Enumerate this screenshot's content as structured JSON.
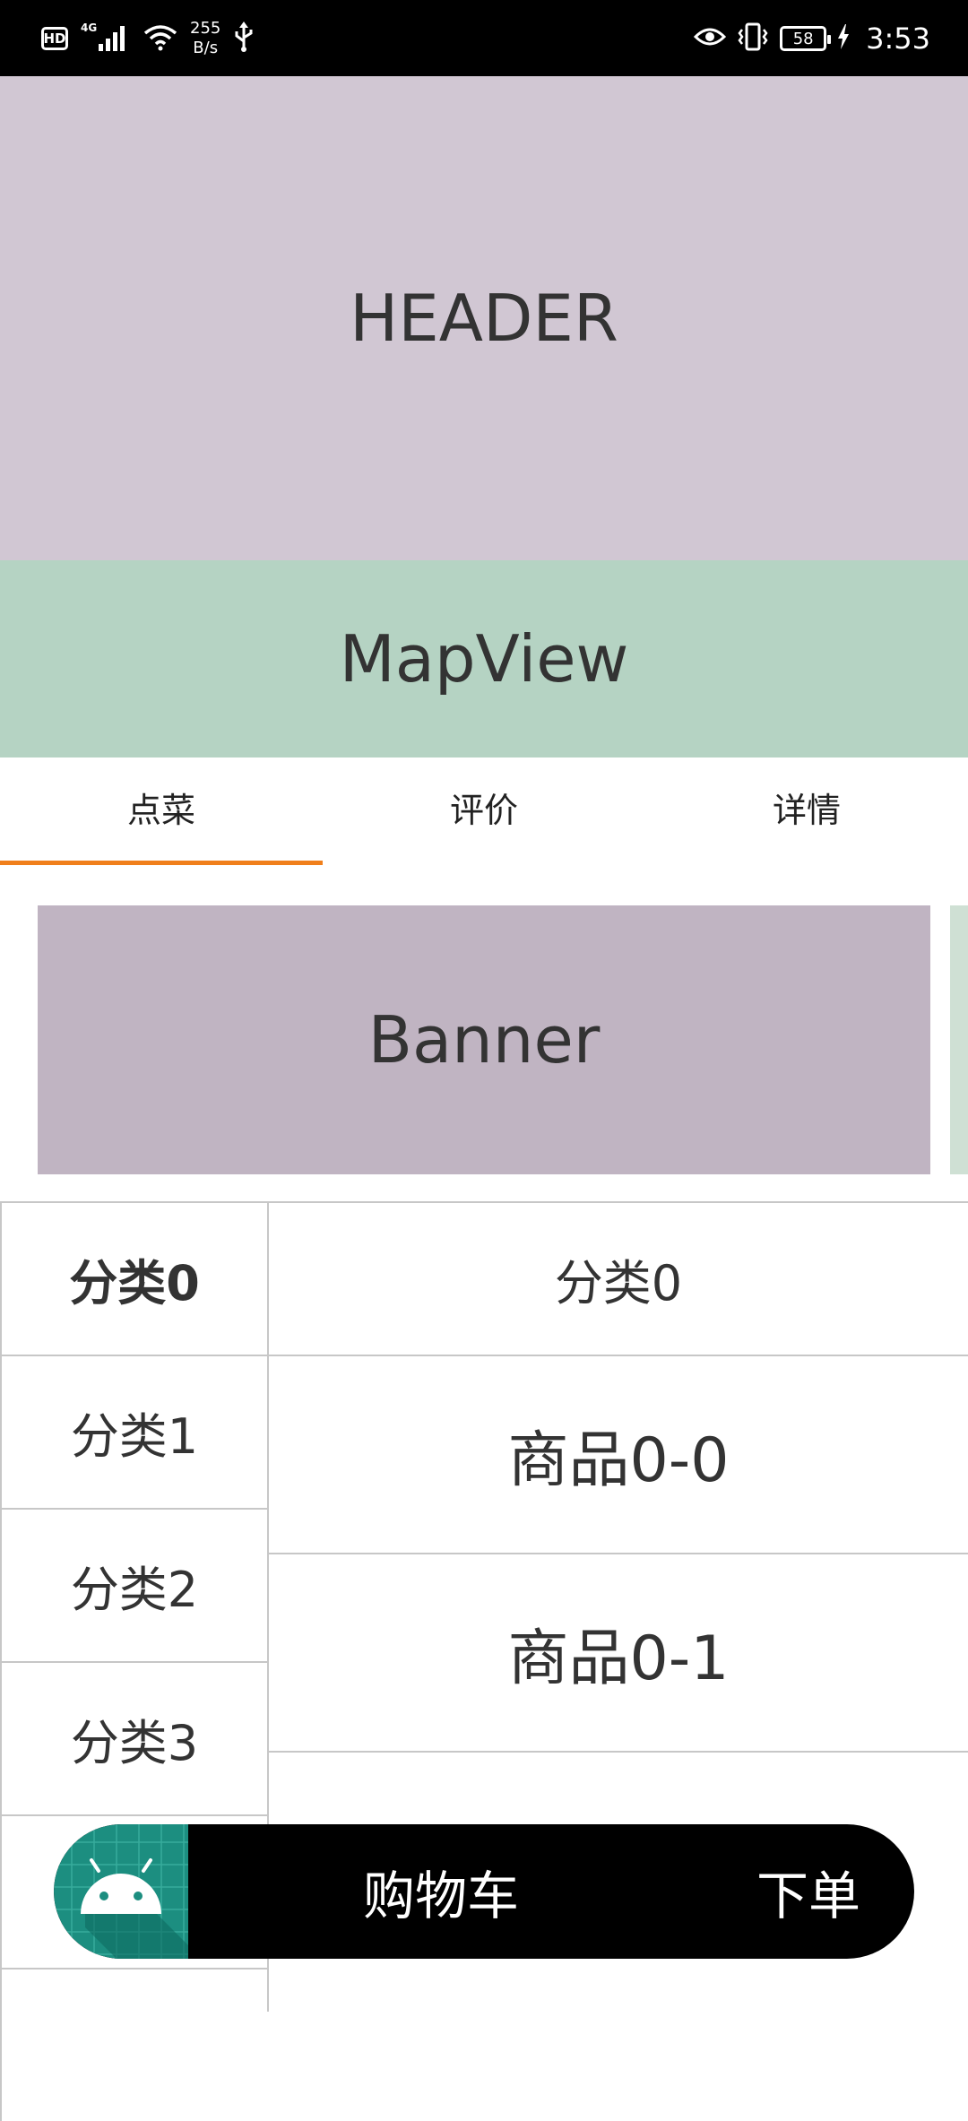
{
  "status_bar": {
    "hd": "HD",
    "network": "4G",
    "speed_value": "255",
    "speed_unit": "B/s",
    "battery": "58",
    "time": "3:53"
  },
  "header": {
    "label": "HEADER"
  },
  "map": {
    "label": "MapView"
  },
  "tabs": [
    {
      "label": "点菜",
      "active": true
    },
    {
      "label": "评价",
      "active": false
    },
    {
      "label": "详情",
      "active": false
    }
  ],
  "banner": {
    "label": "Banner"
  },
  "categories": [
    {
      "label": "分类0",
      "active": true
    },
    {
      "label": "分类1",
      "active": false
    },
    {
      "label": "分类2",
      "active": false
    },
    {
      "label": "分类3",
      "active": false
    }
  ],
  "products": {
    "section_title": "分类0",
    "items": [
      {
        "label": "商品0-0"
      },
      {
        "label": "商品0-1"
      },
      {
        "label": ""
      }
    ]
  },
  "cart_bar": {
    "cart_label": "购物车",
    "checkout_label": "下单"
  },
  "colors": {
    "accent": "#f07f1b",
    "header_bg": "#d1c7d3",
    "map_bg": "#b5d3c3",
    "banner_bg": "#c0b4c2",
    "cart_icon_bg": "#1c8e80"
  }
}
